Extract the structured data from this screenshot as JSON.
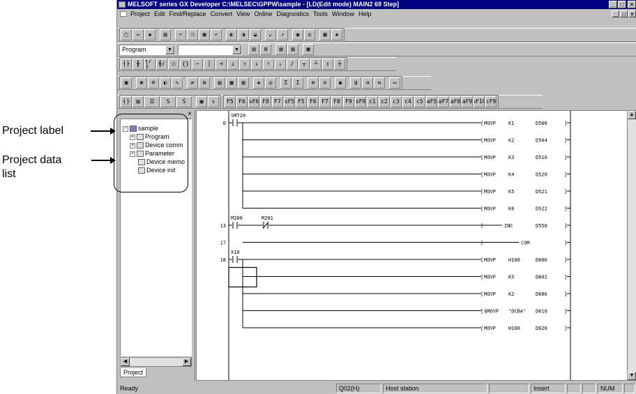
{
  "callouts": {
    "project_label": "Project label",
    "project_data_list_line1": "Project data",
    "project_data_list_line2": "list"
  },
  "window": {
    "title": "MELSOFT series GX Developer C:\\MELSEC\\GPPW\\sample - [LD(Edit mode)    MAIN2    69 Step]",
    "controls": [
      "_",
      "□",
      "×"
    ],
    "mdi_controls": [
      "_",
      "□",
      "×"
    ]
  },
  "menu": [
    "Project",
    "Edit",
    "Find/Replace",
    "Convert",
    "View",
    "Online",
    "Diagnostics",
    "Tools",
    "Window",
    "Help"
  ],
  "toolbar_row3": {
    "combo1_value": "Program",
    "combo2_value": ""
  },
  "toolbar_row4": [
    "F5",
    "sF5",
    "F6",
    "sF6",
    "F7",
    "F8",
    "F9",
    "sF9",
    "cF9",
    "cF10",
    "sF7",
    "sF8",
    "aF7",
    "aF8",
    "aF5",
    "caF5",
    "caF10",
    "F10",
    "aF9"
  ],
  "toolbar_row6": [
    "F5",
    "F6",
    "sF6",
    "F8",
    "F7",
    "sF5",
    "F5",
    "F6",
    "F7",
    "F8",
    "F9",
    "sF9",
    "c1",
    "c2",
    "c3",
    "c4",
    "c5",
    "aF5",
    "aF7",
    "aF8",
    "aF9",
    "aF10",
    "cF9"
  ],
  "project_panel": {
    "close": "×",
    "tab": "Project",
    "tree": [
      {
        "label": "sample",
        "level": 0,
        "expander": "−"
      },
      {
        "label": "Program",
        "level": 1,
        "expander": "+"
      },
      {
        "label": "Device comm",
        "level": 1,
        "expander": "+"
      },
      {
        "label": "Parameter",
        "level": 1,
        "expander": "+"
      },
      {
        "label": "Device memo",
        "level": 1,
        "expander": ""
      },
      {
        "label": "Device init",
        "level": 1,
        "expander": ""
      }
    ]
  },
  "ladder": {
    "rungs": [
      {
        "step": "0",
        "contacts": [
          {
            "device": "SM720",
            "type": "NO"
          }
        ],
        "coil": {
          "instr": "MOVP",
          "s": "K1",
          "d": "D500"
        }
      },
      {
        "step": "",
        "contacts": [],
        "coil": {
          "instr": "MOVP",
          "s": "K2",
          "d": "D504"
        }
      },
      {
        "step": "",
        "contacts": [],
        "coil": {
          "instr": "MOVP",
          "s": "K3",
          "d": "D510"
        }
      },
      {
        "step": "",
        "contacts": [],
        "coil": {
          "instr": "MOVP",
          "s": "K4",
          "d": "D520"
        }
      },
      {
        "step": "",
        "contacts": [],
        "coil": {
          "instr": "MOVP",
          "s": "K5",
          "d": "D521"
        }
      },
      {
        "step": "",
        "contacts": [],
        "coil": {
          "instr": "MOVP",
          "s": "K6",
          "d": "D522"
        }
      },
      {
        "step": "13",
        "contacts": [
          {
            "device": "M200",
            "type": "NO"
          },
          {
            "device": "M201",
            "type": "NC"
          }
        ],
        "coil": {
          "instr": "INC",
          "s": "",
          "d": "D550"
        }
      },
      {
        "step": "17",
        "contacts": [],
        "coil": {
          "instr": "COM",
          "s": "",
          "d": ""
        }
      },
      {
        "step": "18",
        "contacts": [
          {
            "device": "X10",
            "type": "NO"
          }
        ],
        "coil": {
          "instr": "MOVP",
          "s": "H100",
          "d": "D600"
        }
      },
      {
        "step": "",
        "contacts": [],
        "coil": {
          "instr": "MOVP",
          "s": "K5",
          "d": "D602"
        }
      },
      {
        "step": "",
        "contacts": [],
        "coil": {
          "instr": "MOVP",
          "s": "K2",
          "d": "D606"
        }
      },
      {
        "step": "",
        "contacts": [],
        "coil": {
          "instr": "$MOVP",
          "s": "\"DCBA\"",
          "d": "D610"
        }
      },
      {
        "step": "",
        "contacts": [],
        "coil": {
          "instr": "MOVP",
          "s": "H100",
          "d": "D620"
        }
      }
    ]
  },
  "status": {
    "ready": "Ready",
    "cpu": "Q02(H)",
    "station": "Host station",
    "mode": "Insert",
    "numlock": "NUM"
  }
}
